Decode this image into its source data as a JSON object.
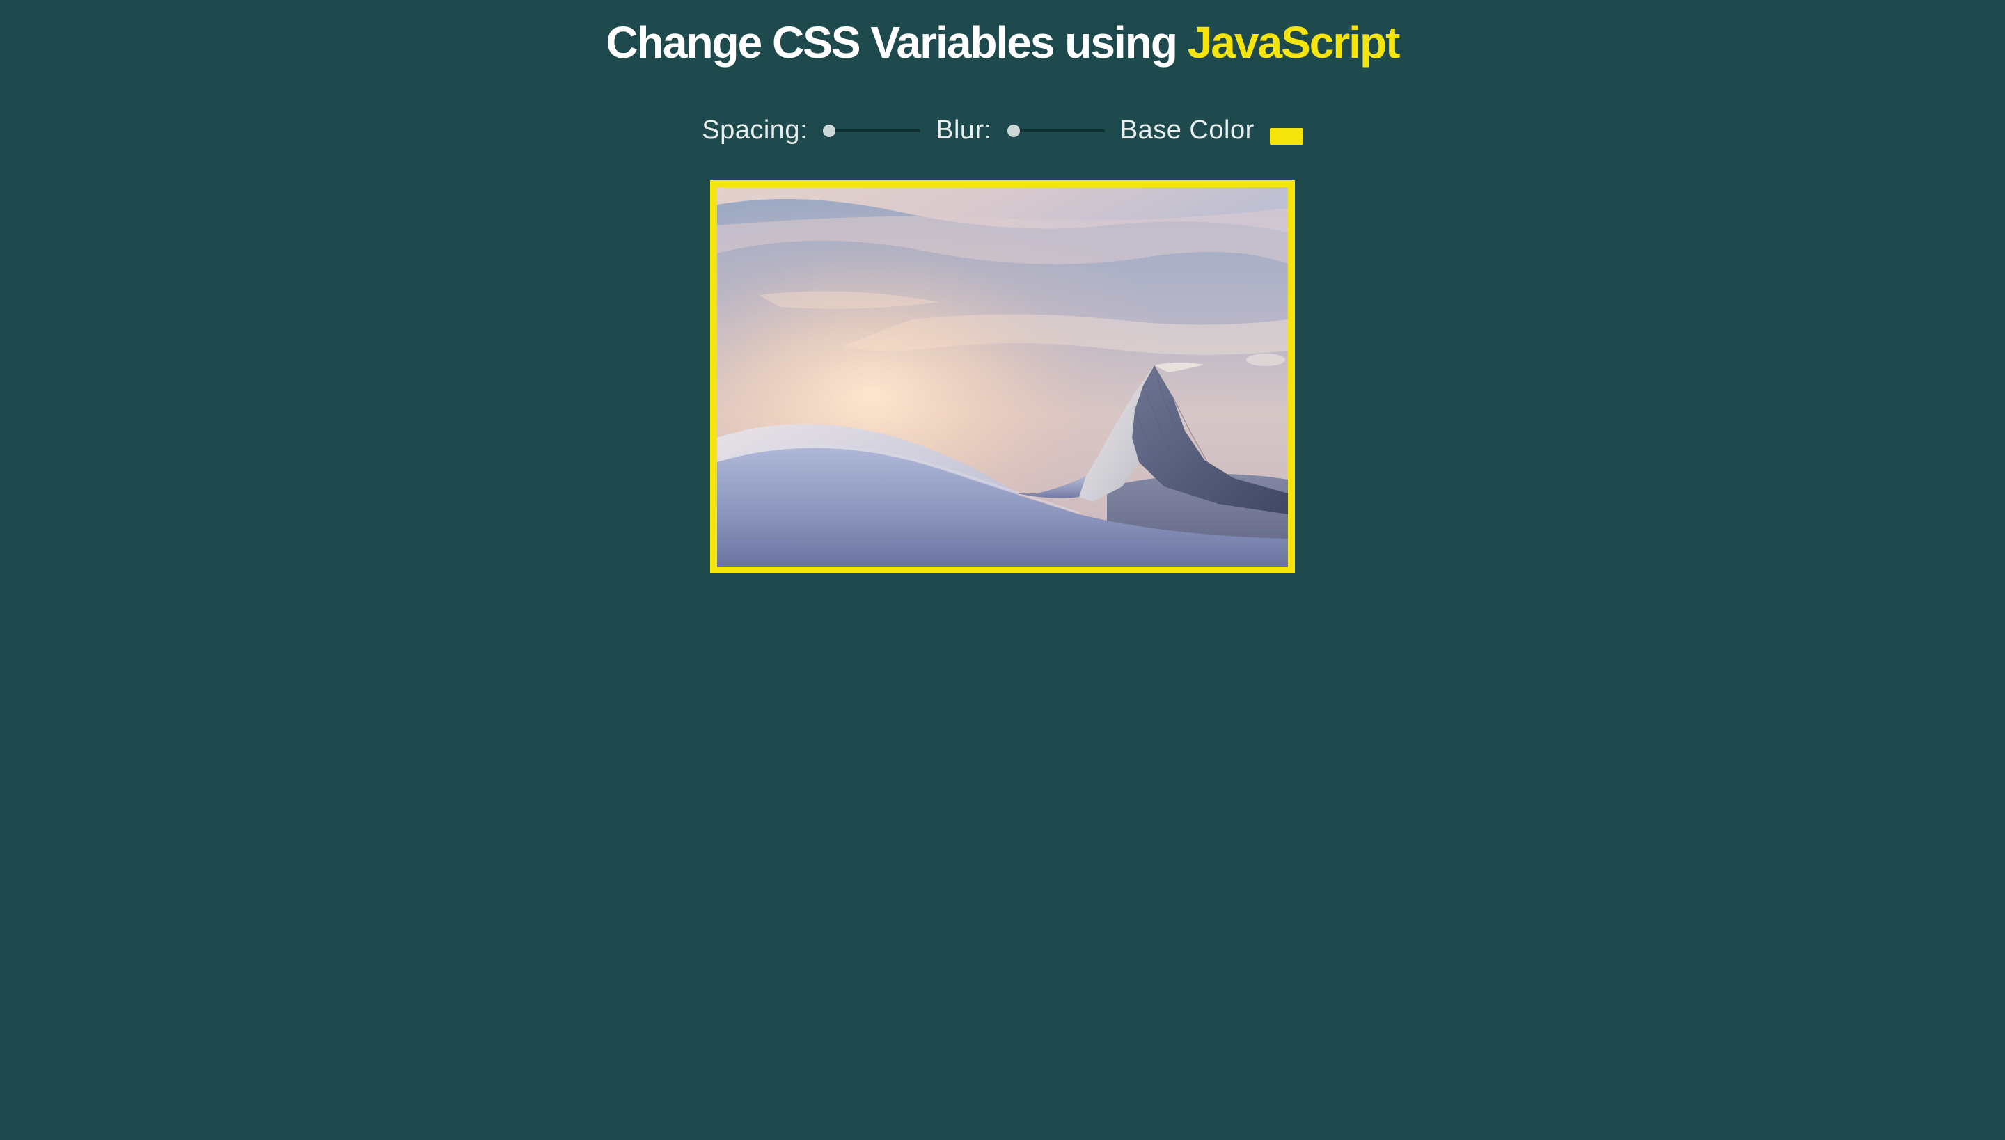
{
  "title": {
    "prefix": "Change CSS Variables using ",
    "highlight": "JavaScript"
  },
  "controls": {
    "spacing": {
      "label": "Spacing:",
      "value": 10,
      "min": 10,
      "max": 200,
      "unit": "px"
    },
    "blur": {
      "label": "Blur:",
      "value": 0,
      "min": 0,
      "max": 25,
      "unit": "px"
    },
    "base": {
      "label": "Base Color",
      "value": "#f5e50c"
    }
  },
  "colors": {
    "background": "#1e4a4e",
    "accent": "#f5e50c",
    "text": "#ffffff"
  }
}
